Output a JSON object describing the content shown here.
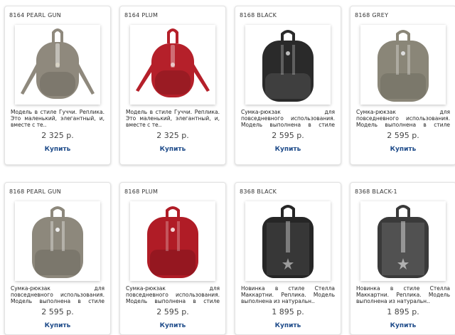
{
  "products": [
    {
      "title": "8164 PEARL GUN",
      "desc": "Модель в стиле Гуччи. Реплика. Это маленький, элегантный, и, вместе с те..",
      "price": "2 325 р.",
      "buy": "Купить",
      "color": "#8f897d"
    },
    {
      "title": "8164 PLUM",
      "desc": "Модель в стиле Гуччи. Реплика. Это маленький, элегантный, и, вместе с те..",
      "price": "2 325 р.",
      "buy": "Купить",
      "color": "#b5202a"
    },
    {
      "title": "8168 BLACK",
      "desc": "Сумка-рюкзак для повседневного использования. Модель выполнена в стиле извест..",
      "price": "2 595 р.",
      "buy": "Купить",
      "color": "#2a2a2a"
    },
    {
      "title": "8168 GREY",
      "desc": "Сумка-рюкзак для повседневного использования. Модель выполнена в стиле извест..",
      "price": "2 595 р.",
      "buy": "Купить",
      "color": "#8a8678"
    },
    {
      "title": "8168 PEARL GUN",
      "desc": "Сумка-рюкзак для повседневного использования. Модель выполнена в стиле извест..",
      "price": "2 595 р.",
      "buy": "Купить",
      "color": "#8d887c"
    },
    {
      "title": "8168 PLUM",
      "desc": "Сумка-рюкзак для повседневного использования. Модель выполнена в стиле извест..",
      "price": "2 595 р.",
      "buy": "Купить",
      "color": "#b01c26"
    },
    {
      "title": "8368 BLACK",
      "desc": "Новинка в стиле Стелла Маккартни. Реплика. Модель выполнена из натуральн..",
      "price": "1 895 р.",
      "buy": "Купить",
      "color": "#262626"
    },
    {
      "title": "8368 BLACK-1",
      "desc": "Новинка в стиле Стелла Маккартни. Реплика. Модель выполнена из натуральн..",
      "price": "1 895 р.",
      "buy": "Купить",
      "color": "#3a3a3a"
    }
  ]
}
